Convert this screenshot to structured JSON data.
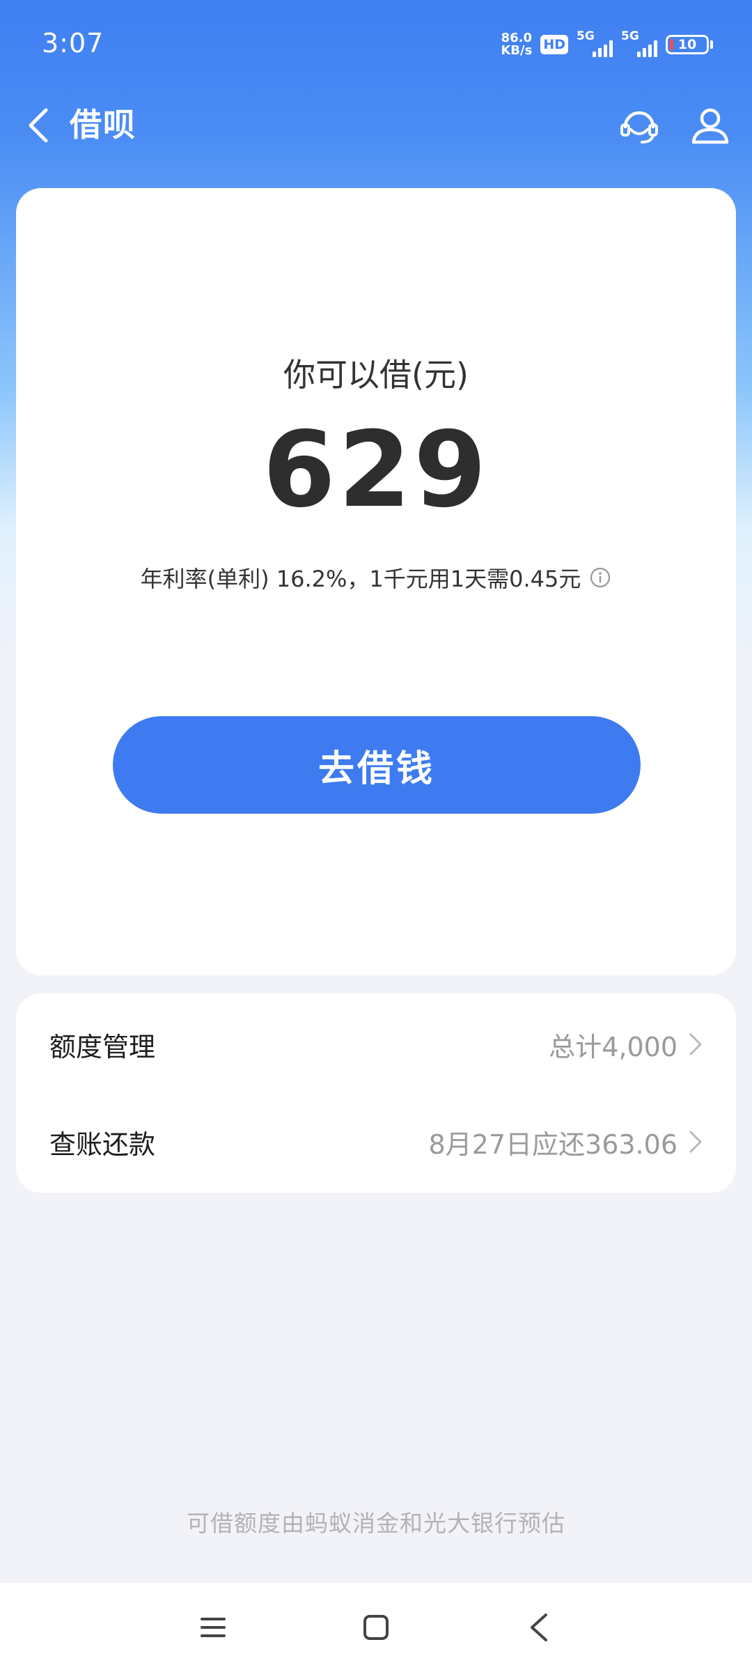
{
  "status_bar": {
    "time": "3:07",
    "net_speed_value": "86.0",
    "net_speed_unit": "KB/s",
    "hd_badge": "HD",
    "signal_1_label": "5G",
    "signal_2_label": "5G",
    "battery_level": "10",
    "battery_fill_fraction": 0.1,
    "battery_low_color": "#ff4a4a"
  },
  "nav": {
    "title": "借呗",
    "back_icon": "chevron-left-icon",
    "service_icon": "customer-service-icon",
    "profile_icon": "user-icon"
  },
  "main_card": {
    "label": "你可以借(元)",
    "amount": "629",
    "rate_text": "年利率(单利) 16.2%，1千元用1天需0.45元",
    "info_icon": "info-icon",
    "borrow_button": "去借钱",
    "accent_color": "#3e7bf0"
  },
  "menu": {
    "items": [
      {
        "label": "额度管理",
        "value": "总计4,000"
      },
      {
        "label": "查账还款",
        "value": "8月27日应还363.06"
      }
    ]
  },
  "footer": {
    "note": "可借额度由蚂蚁消金和光大银行预估"
  },
  "system_nav": {
    "menu_icon": "menu-icon",
    "home_icon": "home-square-icon",
    "back_icon": "back-triangle-icon"
  }
}
